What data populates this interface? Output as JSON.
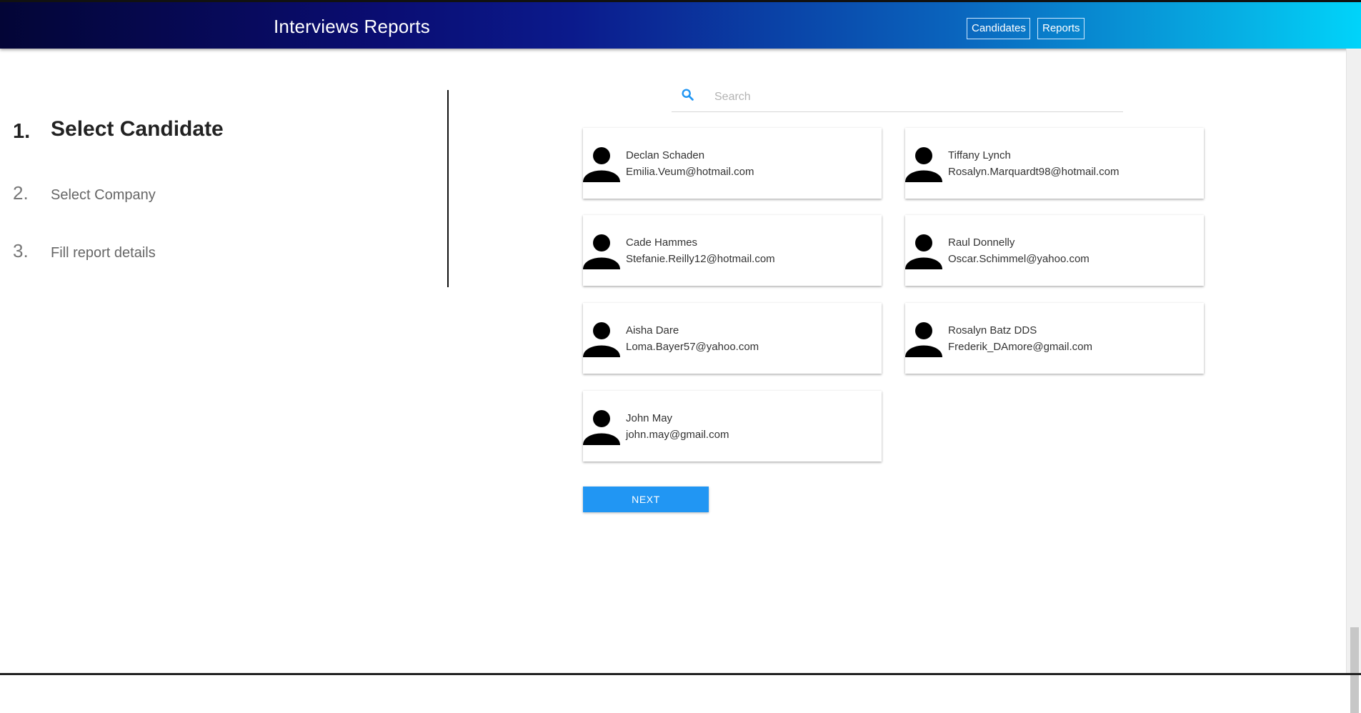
{
  "header": {
    "title": "Interviews Reports",
    "nav": {
      "candidates": "Candidates",
      "reports": "Reports"
    }
  },
  "steps": [
    {
      "number": "1.",
      "label": "Select Candidate",
      "active": true
    },
    {
      "number": "2.",
      "label": "Select Company",
      "active": false
    },
    {
      "number": "3.",
      "label": "Fill report details",
      "active": false
    }
  ],
  "search": {
    "placeholder": "Search",
    "value": "",
    "icon": "search-icon"
  },
  "candidates": [
    {
      "name": "Declan Schaden",
      "email": "Emilia.Veum@hotmail.com"
    },
    {
      "name": "Tiffany Lynch",
      "email": "Rosalyn.Marquardt98@hotmail.com"
    },
    {
      "name": "Cade Hammes",
      "email": "Stefanie.Reilly12@hotmail.com"
    },
    {
      "name": "Raul Donnelly",
      "email": "Oscar.Schimmel@yahoo.com"
    },
    {
      "name": "Aisha Dare",
      "email": "Loma.Bayer57@yahoo.com"
    },
    {
      "name": "Rosalyn Batz DDS",
      "email": "Frederik_DAmore@gmail.com"
    },
    {
      "name": "John May",
      "email": "john.may@gmail.com"
    }
  ],
  "next_label": "NEXT",
  "colors": {
    "header_gradient_start": "#030536",
    "header_gradient_end": "#00d4fa",
    "accent_button": "#2196f3",
    "search_icon": "#2196f3"
  }
}
